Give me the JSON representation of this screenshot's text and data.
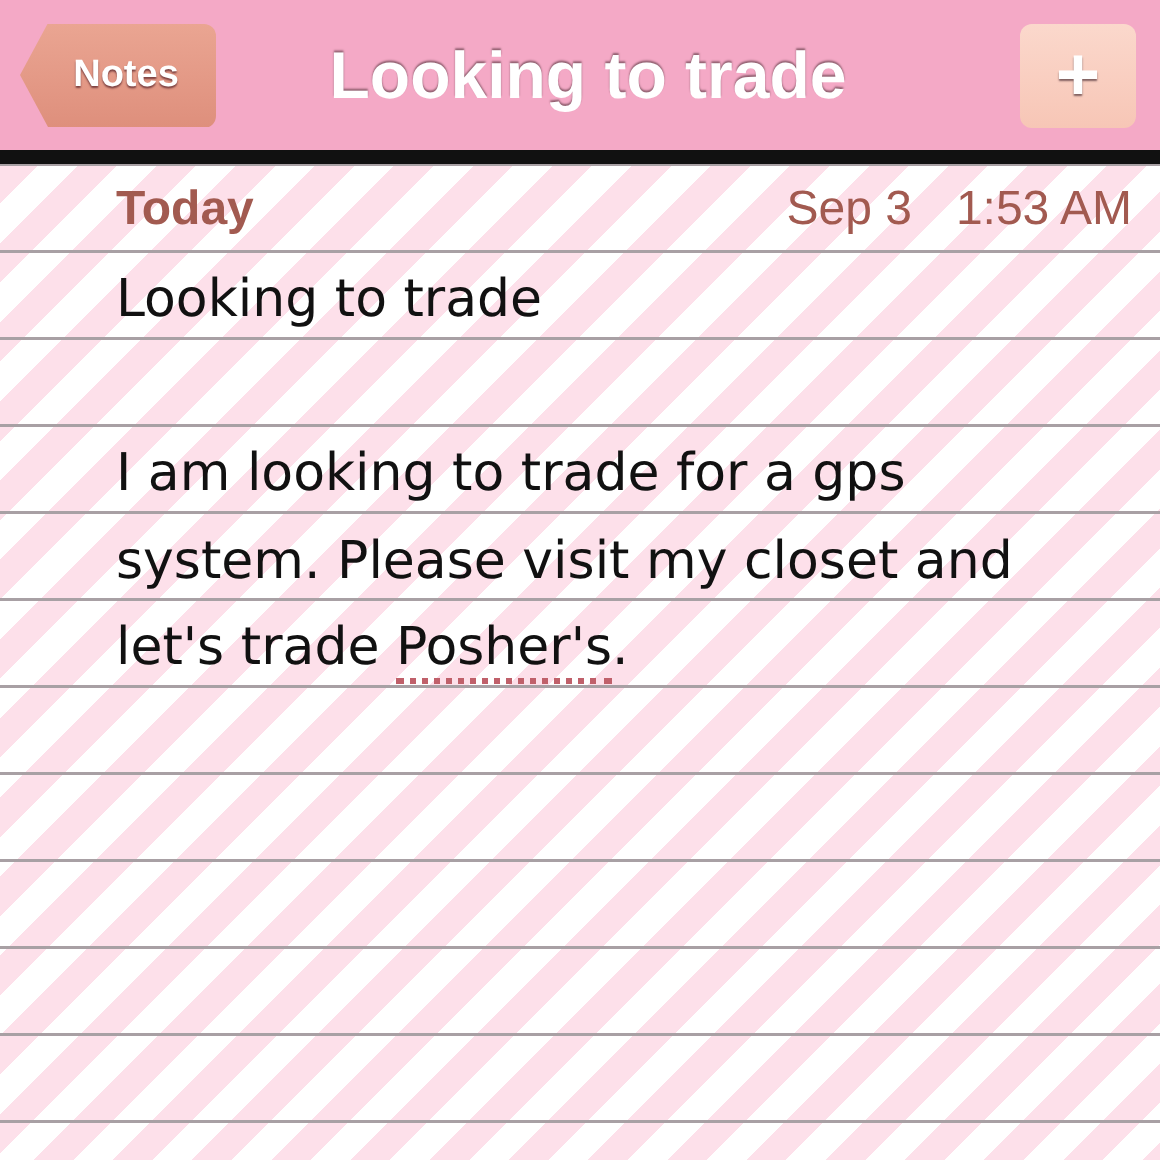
{
  "nav_bar": {
    "back_button": "Notes",
    "title": "Looking to trade",
    "add_button": "+"
  },
  "note": {
    "day": "Today",
    "date": "Sep 3",
    "time": "1:53 AM",
    "paragraphs": [
      [
        {
          "text": "Looking to trade",
          "misspelled": false
        }
      ],
      [
        {
          "text": "I am looking to trade for a gps system. Please visit my closet and let's trade ",
          "misspelled": false
        },
        {
          "text": "Posher's",
          "misspelled": true
        },
        {
          "text": ".",
          "misspelled": false
        }
      ]
    ]
  }
}
